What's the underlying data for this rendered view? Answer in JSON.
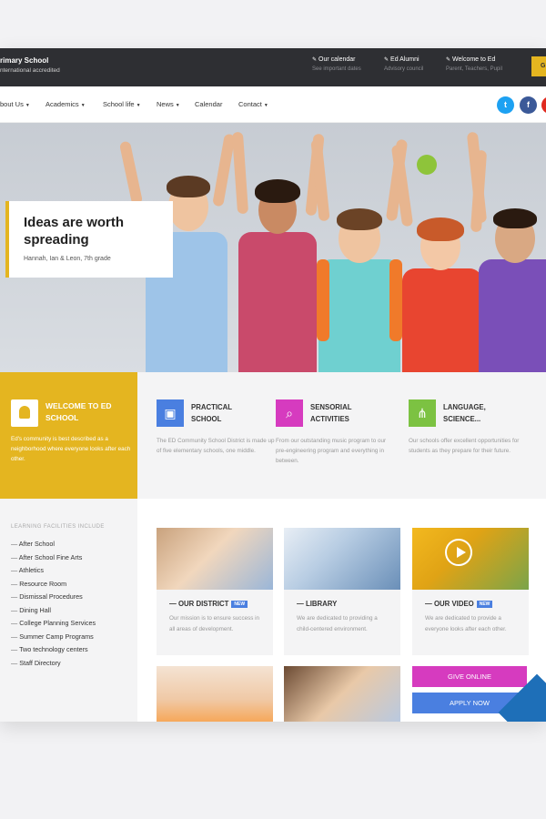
{
  "topbar": {
    "school_name": "rimary School",
    "school_sub": "nternational accredited",
    "links": [
      {
        "title": "Our calendar",
        "sub": "See important dates"
      },
      {
        "title": "Ed Alumni",
        "sub": "Advisory council"
      },
      {
        "title": "Welcome to Ed",
        "sub": "Parent, Teachers, Pupil"
      }
    ],
    "cta_label": "G"
  },
  "nav": {
    "items": [
      "bout Us",
      "Academics",
      "School life",
      "News",
      "Calendar",
      "Contact"
    ],
    "social": [
      "t",
      "f",
      "y"
    ]
  },
  "hero": {
    "title": "Ideas are worth spreading",
    "subtitle": "Hannah, Ian & Leon, 7th grade"
  },
  "welcome": {
    "title": "WELCOME TO ED SCHOOL",
    "text": "Ed's community is best described as a neighborhood where everyone looks after each other."
  },
  "features": [
    {
      "title": "PRACTICAL SCHOOL",
      "text": "The ED Community School District is made up of five elementary schools, one middle.",
      "icon": "bus-icon",
      "color": "#4a7fe0"
    },
    {
      "title": "SENSORIAL ACTIVITIES",
      "text": "From our outstanding music program to our pre-engineering program and everything in between.",
      "icon": "search-doc-icon",
      "color": "#d63bbf"
    },
    {
      "title": "LANGUAGE, SCIENCE...",
      "text": "Our schools offer excellent opportunities for students as they prepare for their future.",
      "icon": "network-icon",
      "color": "#7cc242"
    }
  ],
  "facilities": {
    "heading": "LEARNING FACILITIES INCLUDE",
    "items": [
      "After School",
      "After School Fine Arts",
      "Athletics",
      "Resource Room",
      "Dismissal Procedures",
      "Dining Hall",
      "College Planning Services",
      "Summer Camp Programs",
      "Two technology centers",
      "Staff Directory"
    ]
  },
  "cards": [
    {
      "title": "— OUR DISTRICT",
      "badge": "NEW",
      "text": "Our mission is to ensure success in all areas of development."
    },
    {
      "title": "— LIBRARY",
      "badge": "",
      "text": "We are dedicated to providing a child-centered environment."
    },
    {
      "title": "— OUR VIDEO",
      "badge": "NEW",
      "text": "We are dedicated to provide a everyone looks after each other."
    }
  ],
  "actions": {
    "give_online": "GIVE ONLINE",
    "apply_now": "APPLY NOW"
  },
  "colors": {
    "accent": "#e4b520",
    "dark": "#2e2f33",
    "blue": "#4a7fe0",
    "magenta": "#d63bbf",
    "green": "#7cc242"
  }
}
